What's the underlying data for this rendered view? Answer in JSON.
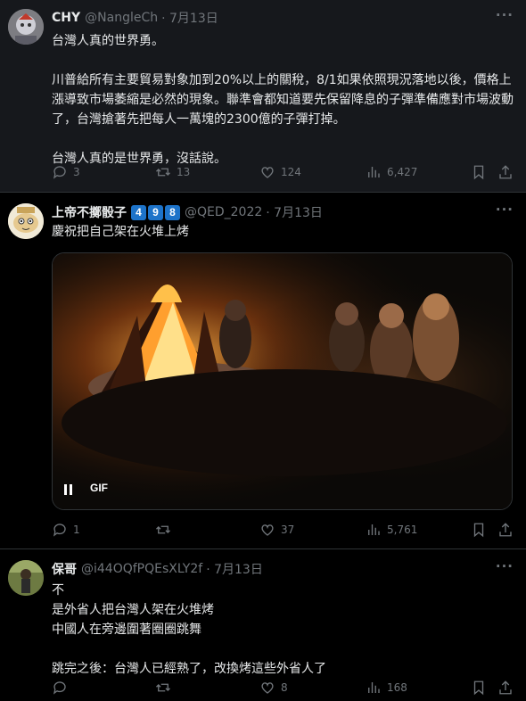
{
  "tweets": [
    {
      "name": "CHY",
      "handle": "@NangleCh",
      "date": "· 7月13日",
      "text": "台灣人真的世界勇。\n\n川普給所有主要貿易對象加到20%以上的關稅，8/1如果依照現況落地以後，價格上漲導致市場萎縮是必然的現象。聯準會都知道要先保留降息的子彈準備應對市場波動了，台灣搶著先把每人一萬塊的2300億的子彈打掉。\n\n台灣人真的是世界勇，沒話說。",
      "replies": "3",
      "retweets": "13",
      "likes": "124",
      "views": "6,427"
    },
    {
      "name": "上帝不擲骰子",
      "badges": [
        "4",
        "9",
        "8"
      ],
      "handle": "@QED_2022",
      "date": "· 7月13日",
      "text": "慶祝把自己架在火堆上烤",
      "media_label": "GIF",
      "replies": "1",
      "retweets": "",
      "likes": "37",
      "views": "5,761"
    },
    {
      "name": "保哥",
      "handle": "@i44OQfPQEsXLY2f",
      "date": "· 7月13日",
      "text": "不\n是外省人把台灣人架在火堆烤\n中國人在旁邊圍著圈圈跳舞\n\n跳完之後：台灣人已經熟了，改換烤這些外省人了",
      "replies": "",
      "retweets": "",
      "likes": "8",
      "views": "168"
    }
  ],
  "colors": {
    "text": "#e7e9ea",
    "muted": "#71767b",
    "badge": "#1d73c9",
    "highlight_bg": "#16181c"
  }
}
